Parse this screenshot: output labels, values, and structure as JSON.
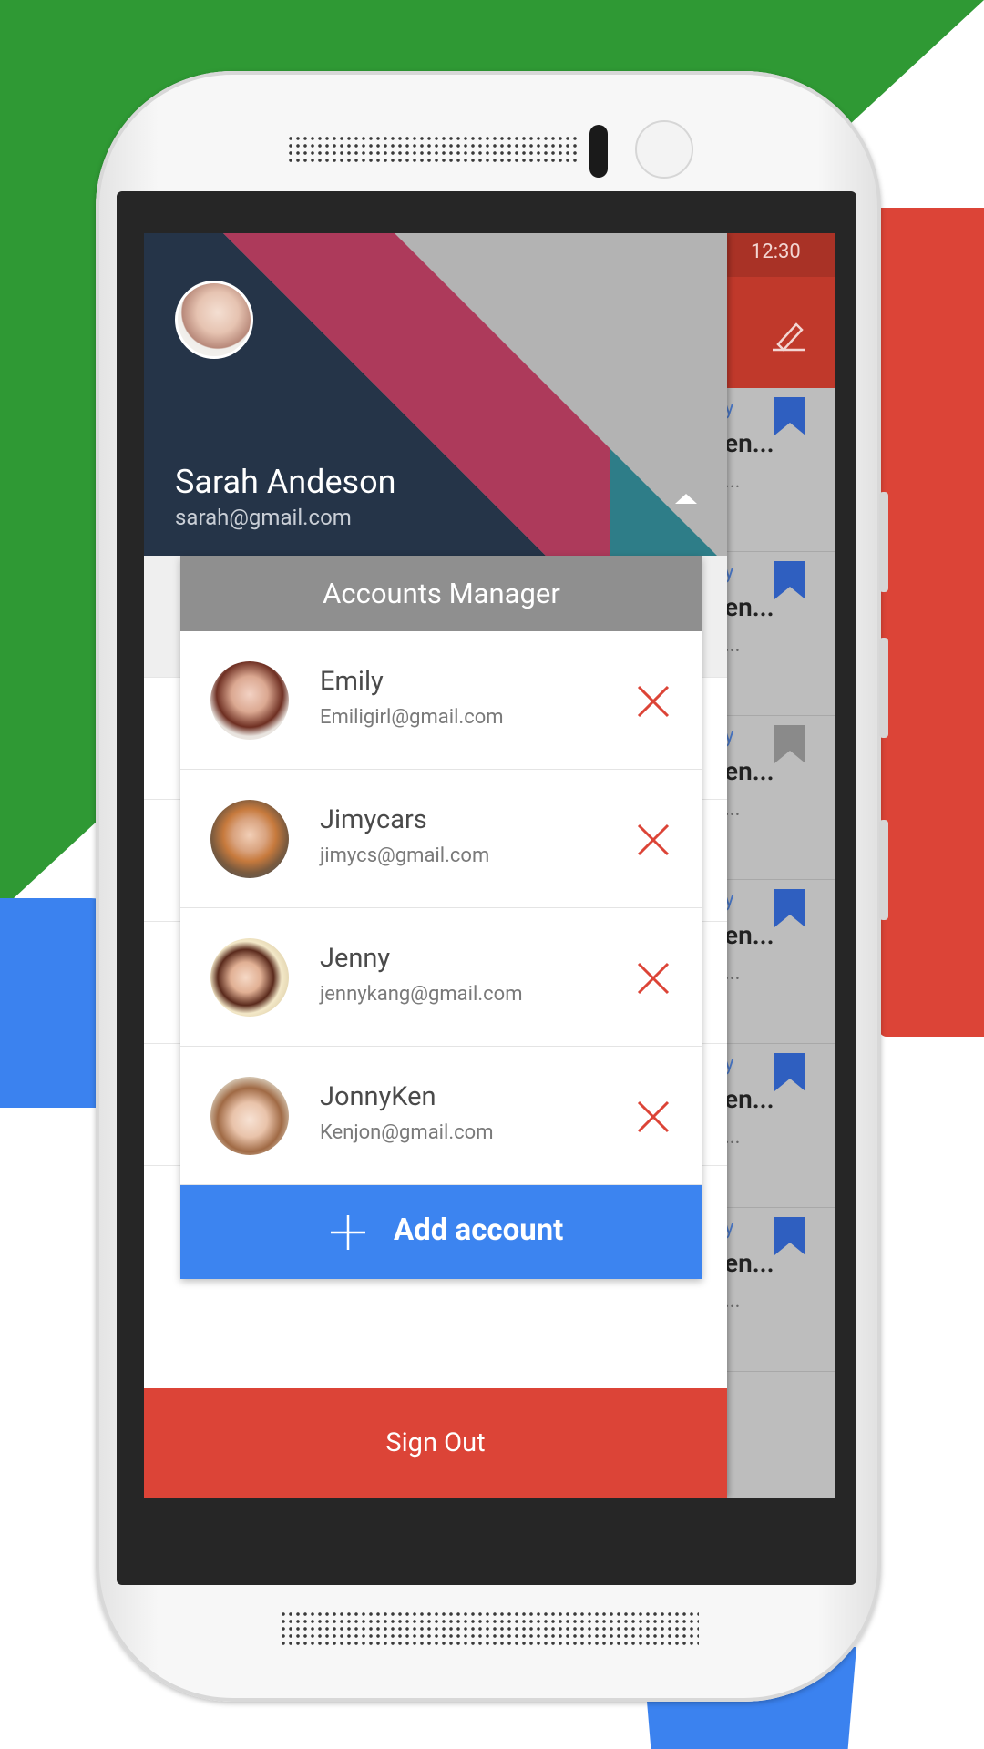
{
  "status_bar": {
    "time": "12:30"
  },
  "drawer": {
    "user_name": "Sarah Andeson",
    "user_email": "sarah@gmail.com",
    "sign_out_label": "Sign Out"
  },
  "accounts_dialog": {
    "title": "Accounts Manager",
    "accounts": [
      {
        "name": "Emily",
        "email": "Emiligirl@gmail.com"
      },
      {
        "name": "Jimycars",
        "email": "jimycs@gmail.com"
      },
      {
        "name": "Jenny",
        "email": "jennykang@gmail.com"
      },
      {
        "name": "JonnyKen",
        "email": "Kenjon@gmail.com"
      }
    ],
    "add_label": "Add account"
  },
  "mail_fragments": [
    {
      "line1": "y",
      "line2": "en...",
      "line3": "..."
    },
    {
      "line1": "y",
      "line2": "en...",
      "line3": "..."
    },
    {
      "line1": "y",
      "line2": "en...",
      "line3": "..."
    },
    {
      "line1": "y",
      "line2": "en...",
      "line3": "..."
    },
    {
      "line1": "y",
      "line2": "en...",
      "line3": "..."
    },
    {
      "line1": "y",
      "line2": "en...",
      "line3": "..."
    }
  ],
  "colors": {
    "accent_red": "#dc4437",
    "accent_blue": "#3c84f0",
    "header_navy": "#253448",
    "bookmark_blue": "#2f5fc0",
    "bookmark_gray": "#8a8a8a"
  }
}
